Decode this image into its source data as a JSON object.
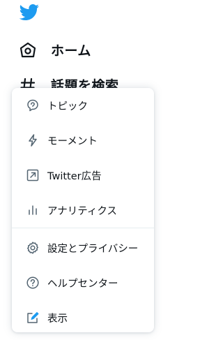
{
  "brand": {
    "logo": "twitter-bird-icon",
    "color": "#1d9bf0"
  },
  "nav": {
    "items": [
      {
        "label": "ホーム",
        "icon": "home-icon"
      },
      {
        "label": "話題を検索",
        "icon": "hashtag-icon"
      }
    ]
  },
  "menu": {
    "items": [
      {
        "label": "トピック",
        "icon": "topics-icon"
      },
      {
        "label": "モーメント",
        "icon": "lightning-icon"
      },
      {
        "label": "Twitter広告",
        "icon": "external-arrow-icon"
      },
      {
        "label": "アナリティクス",
        "icon": "bar-chart-icon"
      },
      {
        "label": "設定とプライバシー",
        "icon": "gear-icon"
      },
      {
        "label": "ヘルプセンター",
        "icon": "help-icon"
      },
      {
        "label": "表示",
        "icon": "display-edit-icon"
      }
    ],
    "accent": "#1d9bf0"
  }
}
